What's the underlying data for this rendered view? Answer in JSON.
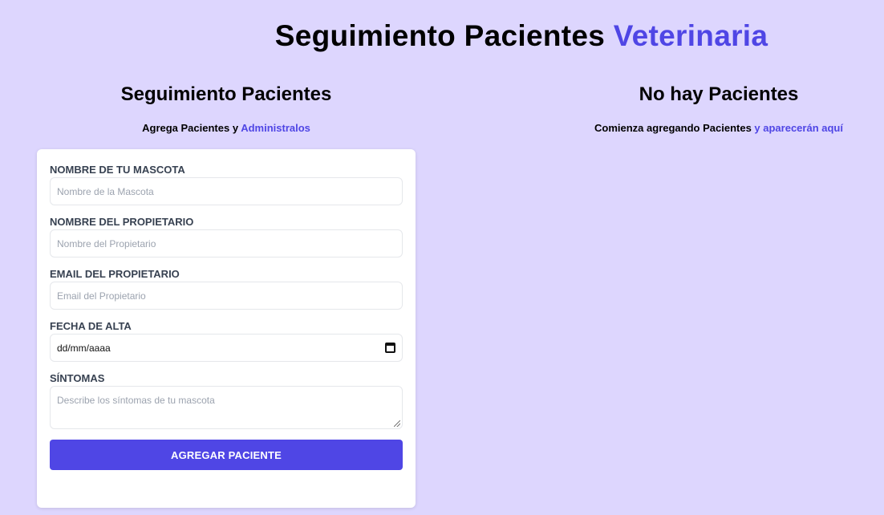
{
  "header": {
    "title_main": "Seguimiento Pacientes",
    "title_accent": "Veterinaria",
    "accent_color": "#4f46e5",
    "background_color": "#ddd6fe"
  },
  "form_section": {
    "title": "Seguimiento Pacientes",
    "subtitle_text": "Agrega Pacientes y",
    "subtitle_accent": "Administralos"
  },
  "form": {
    "pet_name": {
      "label": "NOMBRE DE TU MASCOTA",
      "placeholder": "Nombre de la Mascota"
    },
    "owner_name": {
      "label": "NOMBRE DEL PROPIETARIO",
      "placeholder": "Nombre del Propietario"
    },
    "owner_email": {
      "label": "EMAIL DEL PROPIETARIO",
      "placeholder": "Email del Propietario"
    },
    "discharge_date": {
      "label": "FECHA DE ALTA",
      "value": "dd/mm/aaaa"
    },
    "symptoms": {
      "label": "SÍNTOMAS",
      "placeholder": "Describe los síntomas de tu mascota"
    },
    "submit_label": "AGREGAR PACIENTE"
  },
  "list_section": {
    "title": "No hay Pacientes",
    "subtitle_text": "Comienza agregando Pacientes",
    "subtitle_accent": "y aparecerán aquí"
  }
}
